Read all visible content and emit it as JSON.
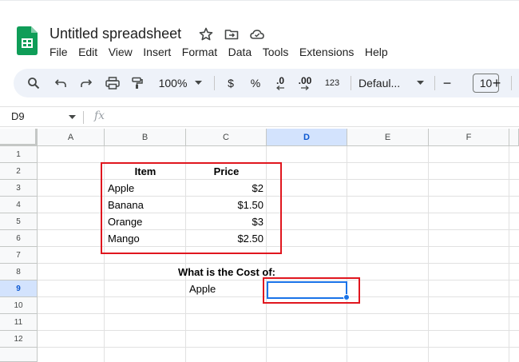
{
  "app": {
    "doc_title": "Untitled spreadsheet",
    "icons": [
      "sheets-logo-icon",
      "star-icon",
      "move-folder-icon",
      "cloud-status-icon"
    ]
  },
  "menu": [
    "File",
    "Edit",
    "View",
    "Insert",
    "Format",
    "Data",
    "Tools",
    "Extensions",
    "Help"
  ],
  "toolbar": {
    "zoom": "100%",
    "currency": "$",
    "percent": "%",
    "decrease_decimal": ".0",
    "increase_decimal": ".00",
    "number_format": "123",
    "font": "Defaul...",
    "font_size": "10",
    "minus": "−",
    "plus": "+"
  },
  "formula_bar": {
    "name_box": "D9",
    "fx": "fx",
    "content": ""
  },
  "columns": [
    "A",
    "B",
    "C",
    "D",
    "E",
    "F"
  ],
  "rows": [
    "1",
    "2",
    "3",
    "4",
    "5",
    "6",
    "7",
    "8",
    "9",
    "10",
    "11",
    "12"
  ],
  "selected": {
    "column": "D",
    "row": "9"
  },
  "table": {
    "headers": {
      "item": "Item",
      "price": "Price"
    },
    "rows": [
      {
        "item": "Apple",
        "price": "$2"
      },
      {
        "item": "Banana",
        "price": "$1.50"
      },
      {
        "item": "Orange",
        "price": "$3"
      },
      {
        "item": "Mango",
        "price": "$2.50"
      }
    ]
  },
  "question": {
    "label": "What is the Cost of:",
    "value": "Apple"
  },
  "colors": {
    "highlight_border": "#e0161e",
    "selection": "#1a73e8",
    "toolbar_bg": "#eef2f9",
    "header_selected_bg": "#d3e3fd"
  }
}
